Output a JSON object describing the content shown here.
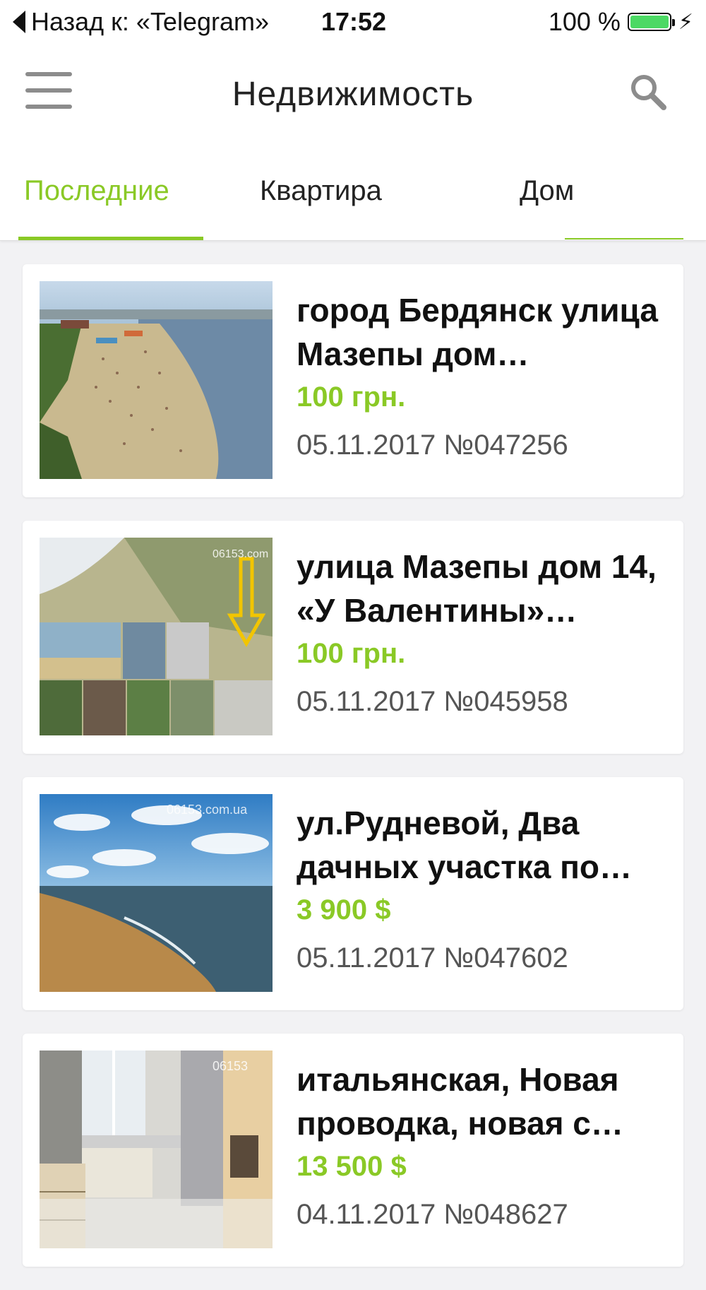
{
  "status_bar": {
    "back_text": "Назад к: «Telegram»",
    "time": "17:52",
    "battery": "100 %"
  },
  "header": {
    "title": "Недвижимость",
    "menu_icon": "hamburger-icon",
    "search_icon": "search-icon"
  },
  "tabs": [
    {
      "label": "Последние",
      "active": true
    },
    {
      "label": "Квартира",
      "active": false
    },
    {
      "label": "Дом",
      "active": false
    }
  ],
  "accent_color": "#8ac926",
  "listings": [
    {
      "title": "город Бердянск улица Мазепы дом…",
      "price": "100 грн.",
      "date_id": "05.11.2017 №047256",
      "image": "beach-crowd-photo"
    },
    {
      "title": "улица Мазепы дом 14, «У Валентины»…",
      "price": "100 грн.",
      "date_id": "05.11.2017 №045958",
      "image": "collage-photo",
      "watermark": "06153.com"
    },
    {
      "title": "ул.Рудневой, Два дачных участка по…",
      "price": "3 900 $",
      "date_id": "05.11.2017 №047602",
      "image": "sea-shore-photo",
      "watermark": "06153.com.ua"
    },
    {
      "title": "итальянская, Новая проводка, новая с…",
      "price": "13 500 $",
      "date_id": "04.11.2017 №048627",
      "image": "room-interior-photo",
      "watermark": "06153"
    }
  ]
}
